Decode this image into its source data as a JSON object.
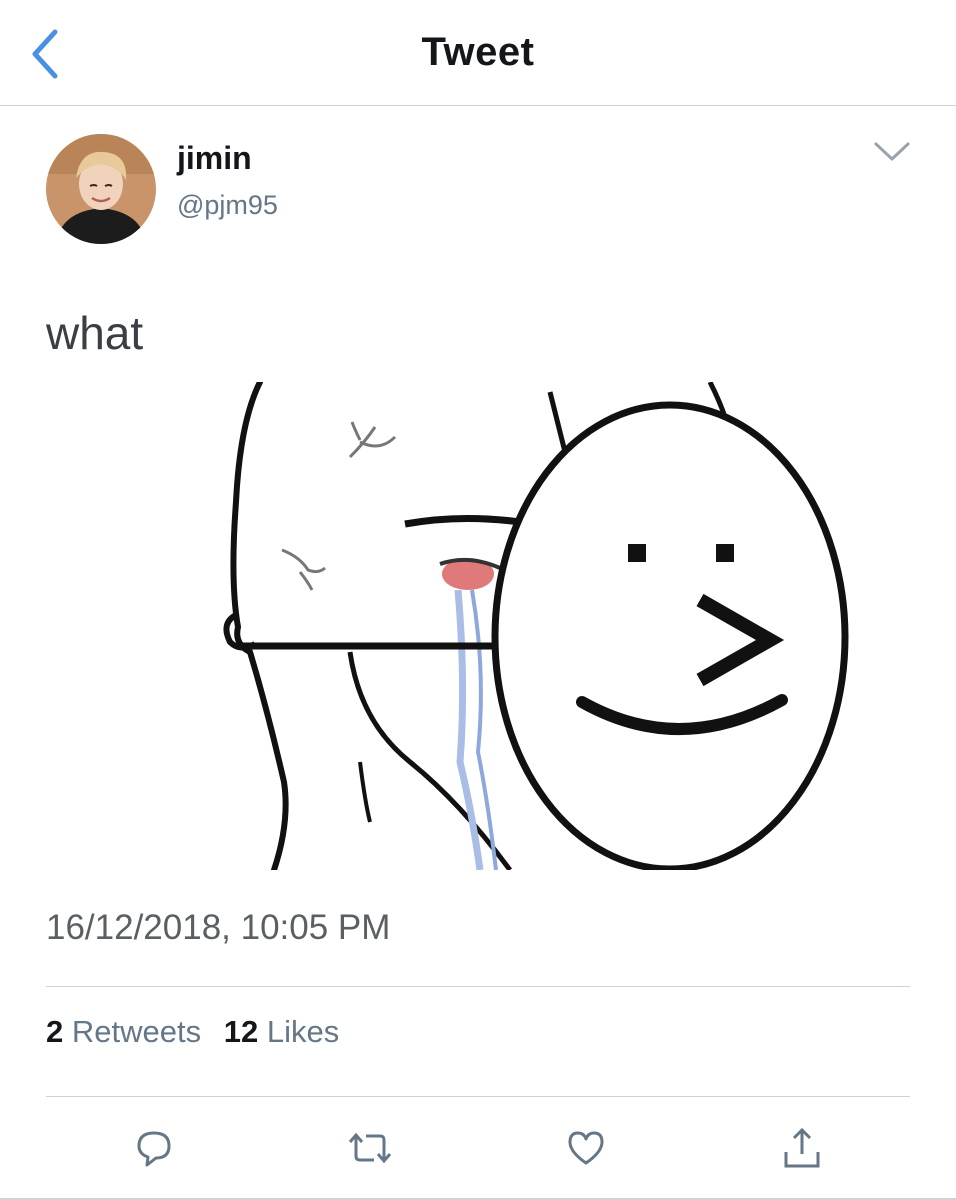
{
  "header": {
    "title": "Tweet",
    "back_icon": "chevron-left-icon",
    "accent_color": "#4a90e2"
  },
  "tweet": {
    "author": {
      "display_name": "jimin",
      "handle": "@pjm95"
    },
    "text": "what",
    "media": {
      "description_icon": "meme-image"
    },
    "timestamp": "16/12/2018, 10:05 PM",
    "stats": {
      "retweets_count": "2",
      "retweets_label": "Retweets",
      "likes_count": "12",
      "likes_label": "Likes"
    }
  },
  "actions": [
    "reply-icon",
    "retweet-icon",
    "like-icon",
    "share-icon"
  ]
}
